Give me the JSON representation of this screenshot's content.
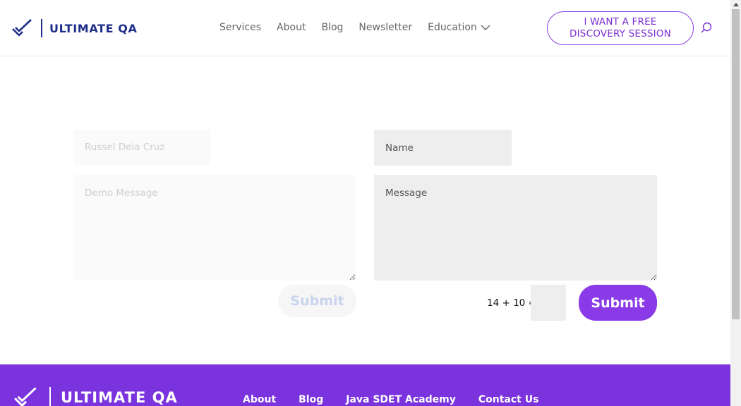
{
  "brand": {
    "name": "ULTIMATE QA",
    "primary": "#1f2f8a",
    "accent": "#8a3ae6"
  },
  "nav": {
    "items": [
      "Services",
      "About",
      "Blog",
      "Newsletter"
    ],
    "education": "Education"
  },
  "cta": {
    "line1": "I WANT A FREE",
    "line2": "DISCOVERY SESSION"
  },
  "forms": {
    "left": {
      "name_placeholder": "Russel Dela Cruz",
      "message_placeholder": "Demo Message",
      "submit": "Submit"
    },
    "right": {
      "name_placeholder": "Name",
      "message_placeholder": "Message",
      "captcha": "14 + 10 =",
      "submit": "Submit"
    }
  },
  "footer": {
    "brand": "ULTIMATE QA",
    "links": [
      "About",
      "Blog",
      "Java SDET Academy",
      "Contact Us"
    ]
  },
  "icons": {
    "search": "search-icon",
    "chevron": "chevron-down-icon",
    "logo": "checkmark-logo-icon"
  }
}
